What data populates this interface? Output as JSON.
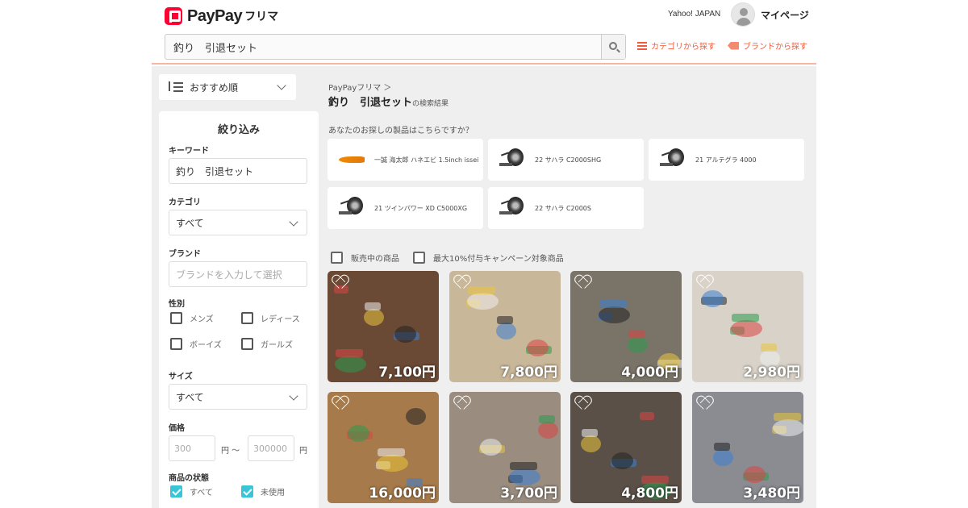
{
  "header": {
    "logo_text": "PayPay",
    "logo_sub": "フリマ",
    "yahoo_link": "Yahoo! JAPAN",
    "mypage": "マイページ",
    "search_value": "釣り　引退セット",
    "category_link": "カテゴリから探す",
    "brand_link": "ブランドから探す"
  },
  "sort": {
    "label": "おすすめ順"
  },
  "filter": {
    "title": "絞り込み",
    "keyword_label": "キーワード",
    "keyword_value": "釣り　引退セット",
    "category_label": "カテゴリ",
    "category_value": "すべて",
    "brand_label": "ブランド",
    "brand_placeholder": "ブランドを入力して選択",
    "gender_label": "性別",
    "genders": [
      {
        "label": "メンズ",
        "checked": false
      },
      {
        "label": "レディース",
        "checked": false
      },
      {
        "label": "ボーイズ",
        "checked": false
      },
      {
        "label": "ガールズ",
        "checked": false
      }
    ],
    "size_label": "サイズ",
    "size_value": "すべて",
    "price_label": "価格",
    "price_min_placeholder": "300",
    "price_max_placeholder": "300000",
    "price_sep": "円 〜",
    "price_unit": "円",
    "condition_label": "商品の状態",
    "conditions": [
      {
        "label": "すべて",
        "checked": true
      },
      {
        "label": "未使用",
        "checked": true
      }
    ]
  },
  "results": {
    "breadcrumb": "PayPayフリマ ＞",
    "query": "釣り　引退セット",
    "query_suffix": "の検索結果",
    "suggest_question": "あなたのお探しの製品はこちらですか？",
    "suggestions": [
      {
        "name": "一誠 海太郎 ハネエビ 1.5inch issei",
        "kind": "lure"
      },
      {
        "name": "22 サハラ C2000SHG",
        "kind": "reel"
      },
      {
        "name": "21 アルテグラ 4000",
        "kind": "reel"
      },
      {
        "name": "21 ツインパワー XD C5000XG",
        "kind": "reel"
      },
      {
        "name": "22 サハラ C2000S",
        "kind": "reel"
      }
    ],
    "on_sale_label": "販売中の商品",
    "campaign_label": "最大10%付与キャンペーン対象商品",
    "items": [
      {
        "price": "7,100円",
        "bg": "#6b4a35"
      },
      {
        "price": "7,800円",
        "bg": "#c9b79a"
      },
      {
        "price": "4,000円",
        "bg": "#7a7468"
      },
      {
        "price": "2,980円",
        "bg": "#d8d2c8"
      },
      {
        "price": "16,000円",
        "bg": "#a67a4a"
      },
      {
        "price": "3,700円",
        "bg": "#9a8d80"
      },
      {
        "price": "4,800円",
        "bg": "#5a5048"
      },
      {
        "price": "3,480円",
        "bg": "#8a8c92"
      }
    ]
  }
}
